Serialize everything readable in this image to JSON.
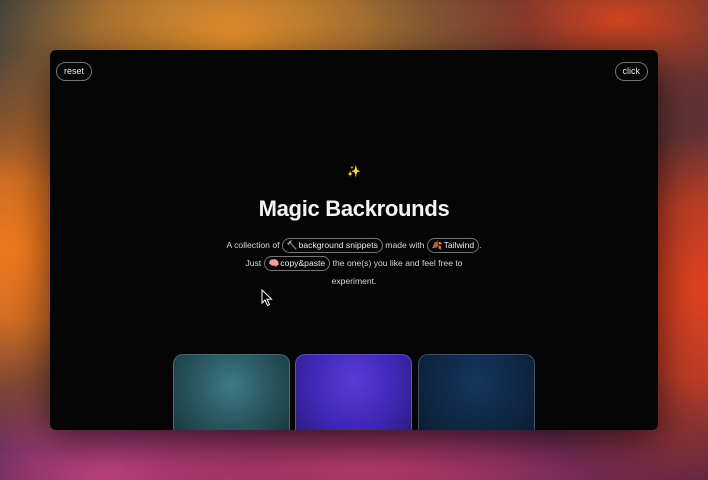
{
  "toolbar": {
    "reset_label": "reset",
    "click_label": "click"
  },
  "hero": {
    "sparkle": "✨",
    "title": "Magic Backrounds",
    "line1_prefix": "A collection of",
    "chip_snippets_icon": "🔨",
    "chip_snippets_label": "background snippets",
    "line1_middle": "made with",
    "chip_tailwind_icon": "🍂",
    "chip_tailwind_label": "Tailwind",
    "line1_suffix": ".",
    "line2_prefix": "Just",
    "chip_paste_icon": "🧠",
    "chip_paste_label": "copy&paste",
    "line2_suffix": "the one(s) you like and feel free to",
    "line3": "experiment."
  },
  "cards": [
    {
      "name": "teal-background",
      "color": "#2a5862"
    },
    {
      "name": "violet-background",
      "color": "#4128b8"
    },
    {
      "name": "navy-background",
      "color": "#0f2744"
    }
  ],
  "colors": {
    "window_bg": "#050505",
    "text": "#f4f4f4",
    "pill_border": "rgba(255,255,255,0.45)"
  },
  "icons": {
    "cursor": "mouse-pointer-icon"
  }
}
